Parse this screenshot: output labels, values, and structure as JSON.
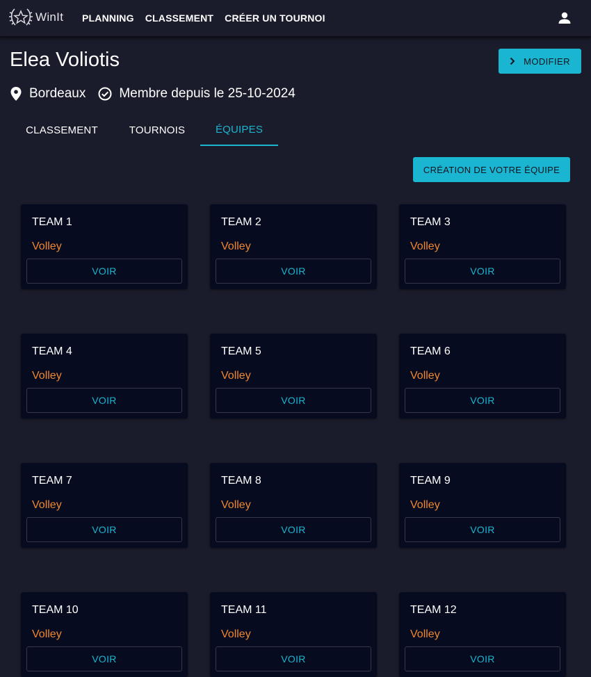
{
  "brand": {
    "name": "WinIt",
    "logo_icon": "laurel-star-icon"
  },
  "nav": {
    "items": [
      "PLANNING",
      "CLASSEMENT",
      "CRÉER UN TOURNOI"
    ],
    "account_icon": "user-icon"
  },
  "profile": {
    "name": "Elea Voliotis",
    "edit_label": "MODIFIER",
    "location": "Bordeaux",
    "member_since": "Membre depuis le 25-10-2024"
  },
  "tabs": [
    {
      "label": "CLASSEMENT",
      "active": false
    },
    {
      "label": "TOURNOIS",
      "active": false
    },
    {
      "label": "ÉQUIPES",
      "active": true
    }
  ],
  "create_team_label": "CRÉATION DE VOTRE ÉQUIPE",
  "teams": [
    {
      "name": "TEAM 1",
      "sport": "Volley",
      "action": "VOIR"
    },
    {
      "name": "TEAM 2",
      "sport": "Volley",
      "action": "VOIR"
    },
    {
      "name": "TEAM 3",
      "sport": "Volley",
      "action": "VOIR"
    },
    {
      "name": "TEAM 4",
      "sport": "Volley",
      "action": "VOIR"
    },
    {
      "name": "TEAM 5",
      "sport": "Volley",
      "action": "VOIR"
    },
    {
      "name": "TEAM 6",
      "sport": "Volley",
      "action": "VOIR"
    },
    {
      "name": "TEAM 7",
      "sport": "Volley",
      "action": "VOIR"
    },
    {
      "name": "TEAM 8",
      "sport": "Volley",
      "action": "VOIR"
    },
    {
      "name": "TEAM 9",
      "sport": "Volley",
      "action": "VOIR"
    },
    {
      "name": "TEAM 10",
      "sport": "Volley",
      "action": "VOIR"
    },
    {
      "name": "TEAM 11",
      "sport": "Volley",
      "action": "VOIR"
    },
    {
      "name": "TEAM 12",
      "sport": "Volley",
      "action": "VOIR"
    }
  ],
  "colors": {
    "background": "#1b1c2b",
    "card": "#070b1f",
    "accent": "#1ab6d1",
    "sport": "#f0872f"
  }
}
